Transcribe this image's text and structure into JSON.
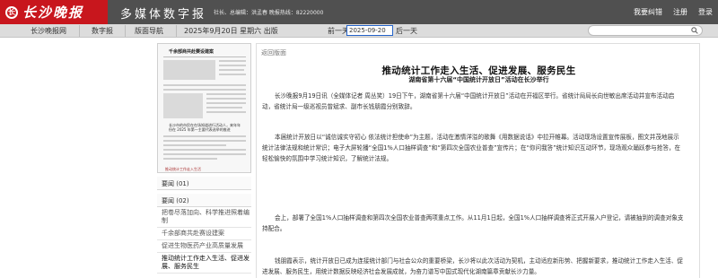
{
  "header": {
    "logo_text": "长沙晚报",
    "logo_mark": "长",
    "app_title": "多媒体数字报",
    "contact": "社长、总编辑：洪孟春  晚报热线：82220000",
    "links": [
      "我要纠错",
      "注册",
      "登录"
    ]
  },
  "nav": {
    "tabs": [
      "长沙晚报网",
      "数字报",
      "版面导航"
    ],
    "date_line": "2025年9月20日 星期六 出版",
    "prev_day": "前一天",
    "date_value": "2025-09-20",
    "next_day": "后一天",
    "search_placeholder": ""
  },
  "thumbnail": {
    "headline": "千余部商共赴赛设建案",
    "headline2": "长沙市的市民在在场知道进行活动人，来年年份在 2025 年第一主要代表选举的推进",
    "caption": "推动统计工作走入生活"
  },
  "left_sections": [
    "要闻 (01)",
    "要闻 (02)"
  ],
  "articles": [
    "把卷尽落加向、科学推进照着编制",
    "千余部商共赴赛设建案",
    "促进生物医药产业高质量发展",
    "推动统计工作走入生活、促进发展、服务民生"
  ],
  "main": {
    "back_link": "返回版面",
    "title": "推动统计工作走入生活、促进发展、服务民生",
    "subtitle": "湖南省第十六届“中国统计开放日”活动在长沙举行",
    "paragraphs": [
      "长沙晚报9月19日讯（全媒体记者 周丛笑）19日下午，湖南省第十六届“中国统计开放日”活动在开福区举行。省统计局局长向世敏出席活动并宣布活动启动，省统计局一级巡视员曾斌求、副市长钱朋霞分别致辞。",
      "本届统计开放日以“诚信诚实守初心 依法统计担使命”为主题，活动在激情洋溢的歌舞《用数据说话》中拉开帷幕。活动现场设置宣传展板，图文并茂地展示统计法律法规和统计常识；电子大屏轮播“全国1%人口抽样调查”和“第四次全国农业普查”宣传片；在“你问我答”统计知识互动环节，现场观众踊跃参与抢答，在轻松愉快的氛围中学习统计知识，了解统计法规。",
      "会上，部署了全国1%人口抽样调查和第四次全国农业普查两项重点工作。从11月1日起，全国1%人口抽样调查将正式开展入户登记，请被抽到的调查对象支持配合。",
      "钱朋霞表示，统计开放日已成为连接统计部门与社会公众的重要桥梁，长沙将以此次活动为契机，主动适应新形势、把握新要求，推动统计工作走入生活、促进发展、服务民生，用统计数据反映经济社会发展成就，为奋力谱写中国式现代化湖南篇章贡献长沙力量。"
    ]
  },
  "colors": {
    "brand_red": "#c8161d",
    "header_gray": "#505050",
    "nav_gray": "#dcdcdc",
    "date_input_border": "#2563c9"
  }
}
